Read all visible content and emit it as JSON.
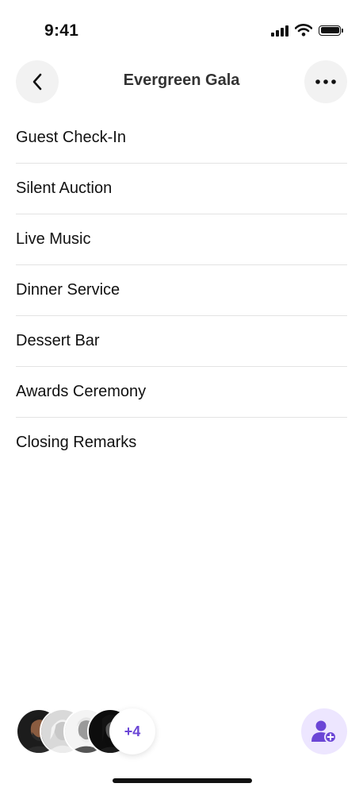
{
  "status_bar": {
    "time": "9:41",
    "icons": [
      "cellular-signal-icon",
      "wifi-icon",
      "battery-icon"
    ]
  },
  "header": {
    "title": "Evergreen Gala",
    "back_icon": "chevron-left-icon",
    "more_icon": "ellipsis-icon"
  },
  "sessions": [
    {
      "label": "Guest Check-In"
    },
    {
      "label": "Silent Auction"
    },
    {
      "label": "Live Music"
    },
    {
      "label": "Dinner Service"
    },
    {
      "label": "Dessert Bar"
    },
    {
      "label": "Awards Ceremony"
    },
    {
      "label": "Closing Remarks"
    }
  ],
  "members": {
    "avatars": [
      "avatar-1",
      "avatar-2",
      "avatar-3",
      "avatar-4"
    ],
    "extra_count": "+4"
  },
  "add_member": {
    "icon": "add-person-icon"
  },
  "colors": {
    "accent": "#6b46d6",
    "accent_soft": "#ede6ff",
    "button_bg": "#f2f2f2",
    "divider": "#e3e3e3"
  }
}
